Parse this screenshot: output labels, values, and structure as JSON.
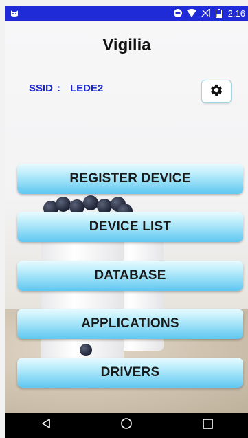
{
  "status_bar": {
    "time": "2:16",
    "icons": [
      "android-cat-icon",
      "do-not-disturb-icon",
      "wifi-icon",
      "no-signal-icon",
      "battery-icon"
    ],
    "background_color": "#1f2bd6"
  },
  "app": {
    "title": "Vigilia"
  },
  "network": {
    "ssid_label": "SSID",
    "separator": ":",
    "ssid_value": "LEDE2",
    "color": "#1c27cf"
  },
  "settings": {
    "icon": "gear-icon"
  },
  "menu": {
    "items": [
      {
        "label": "REGISTER DEVICE"
      },
      {
        "label": "DEVICE LIST"
      },
      {
        "label": "DATABASE"
      },
      {
        "label": "APPLICATIONS"
      },
      {
        "label": "DRIVERS"
      }
    ],
    "button_color": "#5fc7f0"
  },
  "nav_bar": {
    "buttons": [
      "back-icon",
      "home-icon",
      "recents-icon"
    ]
  }
}
